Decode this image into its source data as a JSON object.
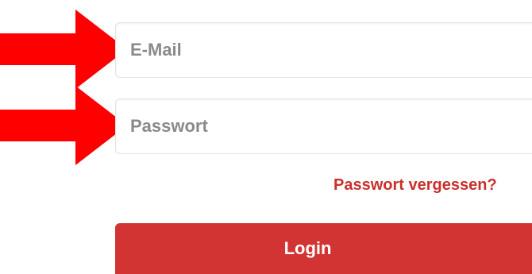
{
  "form": {
    "email_placeholder": "E-Mail",
    "email_value": "",
    "password_placeholder": "Passwort",
    "password_value": "",
    "forgot_password_link": "Passwort vergessen?",
    "login_button": "Login"
  },
  "annotations": {
    "arrow_color": "#ff0000",
    "arrow_icon": "right-arrow-icon"
  },
  "colors": {
    "accent_red": "#d23434",
    "link_red": "#c9302c",
    "placeholder_gray": "#8a8a8a"
  }
}
